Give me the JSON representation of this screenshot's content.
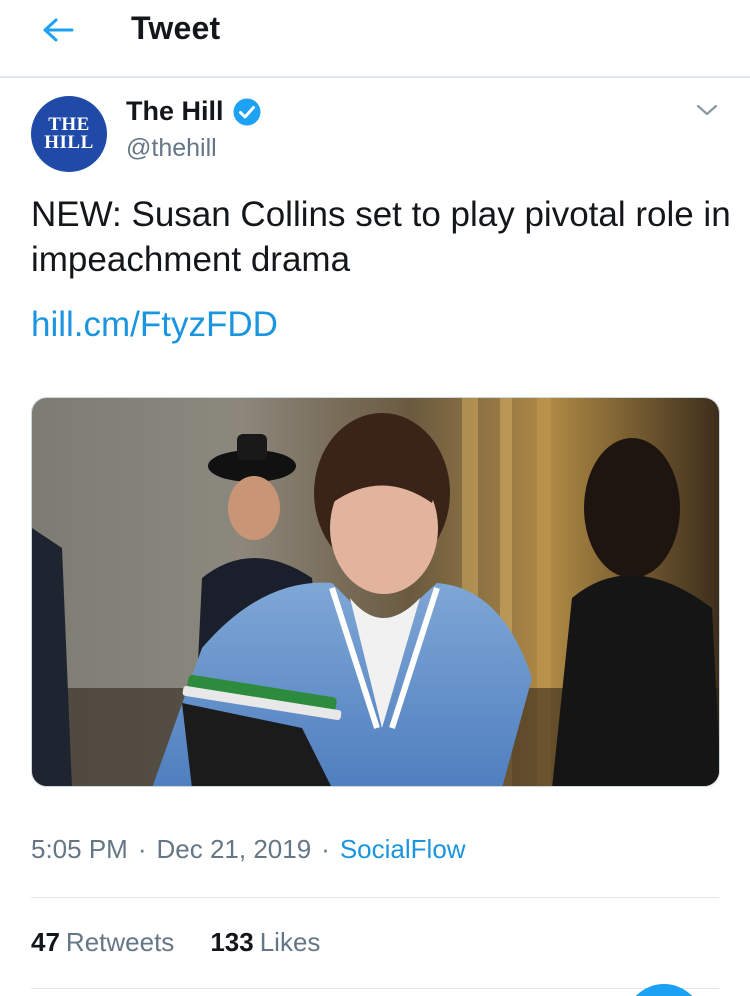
{
  "header": {
    "title": "Tweet",
    "back_icon": "arrow-left-icon"
  },
  "author": {
    "avatar_lines": [
      "THE",
      "HILL"
    ],
    "display_name": "The Hill",
    "handle": "@thehill",
    "verified": true
  },
  "tweet": {
    "text": "NEW: Susan Collins set to play pivotal role in impeachment drama",
    "link": "hill.cm/FtyzFDD"
  },
  "meta": {
    "time": "5:05 PM",
    "date": "Dec 21, 2019",
    "separator": "·",
    "source": "SocialFlow"
  },
  "stats": {
    "retweets_count": "47",
    "retweets_label": "Retweets",
    "likes_count": "133",
    "likes_label": "Likes"
  },
  "colors": {
    "accent": "#1b95e0",
    "text": "#14171a",
    "secondary": "#657786",
    "border": "#e1e8ed",
    "avatar_bg": "#1f4aa7",
    "verified": "#1da1f2"
  }
}
